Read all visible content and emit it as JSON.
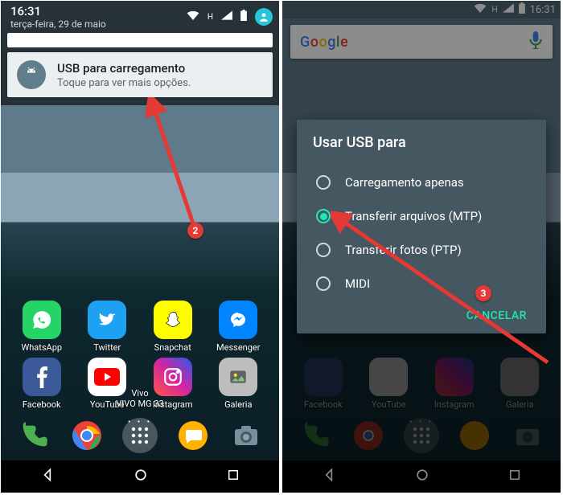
{
  "status": {
    "time": "16:31"
  },
  "shade": {
    "time": "16:31",
    "date": "terça-feira, 29 de maio"
  },
  "notification": {
    "title": "USB para carregamento",
    "subtitle": "Toque para ver mais opções."
  },
  "google_label": "Google",
  "dialog": {
    "title": "Usar USB para",
    "options": [
      {
        "label": "Carregamento apenas",
        "selected": false
      },
      {
        "label": "Transferir arquivos (MTP)",
        "selected": true
      },
      {
        "label": "Transferir fotos (PTP)",
        "selected": false
      },
      {
        "label": "MIDI",
        "selected": false
      }
    ],
    "cancel": "CANCELAR"
  },
  "apps_row1": [
    {
      "label": "WhatsApp",
      "bg": "#25D366",
      "fg": "#fff"
    },
    {
      "label": "Twitter",
      "bg": "#1DA1F2",
      "fg": "#fff"
    },
    {
      "label": "Snapchat",
      "bg": "#FFFC00",
      "fg": "#000"
    },
    {
      "label": "Messenger",
      "bg": "#0084FF",
      "fg": "#fff"
    }
  ],
  "apps_row2": [
    {
      "label": "Facebook",
      "bg": "#3b5998",
      "fg": "#fff"
    },
    {
      "label": "YouTube",
      "bg": "#ffffff",
      "fg": "#FF0000"
    },
    {
      "label": "Instagram",
      "bg": "linear-gradient(45deg,#fd5949,#d6249f,#285AEB)",
      "fg": "#fff"
    },
    {
      "label": "Galeria",
      "bg": "#9e9e9e",
      "fg": "#fff"
    }
  ],
  "carrier": {
    "name": "Vivo",
    "model": "VIVO MG 33"
  },
  "annotations": {
    "step2": "2",
    "step3": "3"
  }
}
